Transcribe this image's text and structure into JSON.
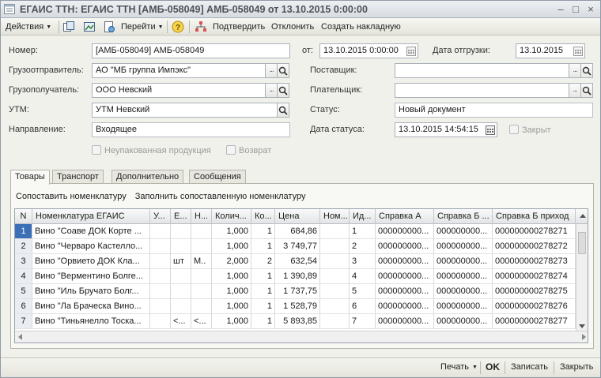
{
  "window": {
    "title": "ЕГАИС ТТН: ЕГАИС ТТН [АМБ-058049] АМБ-058049 от 13.10.2015 0:00:00",
    "controls": [
      "minimize-icon",
      "restore-icon",
      "close-icon"
    ]
  },
  "toolbar": {
    "actions_label": "Действия",
    "goto_label": "Перейти",
    "confirm_label": "Подтвердить",
    "reject_label": "Отклонить",
    "create_invoice_label": "Создать накладную",
    "icons": [
      "copy-icon",
      "image-icon",
      "document-refresh-icon",
      "help-icon",
      "structure-icon"
    ]
  },
  "form": {
    "number_label": "Номер:",
    "number_value": "[АМБ-058049] АМБ-058049",
    "date_from_label": "от:",
    "date_from_value": "13.10.2015  0:00:00",
    "shipment_date_label": "Дата отгрузки:",
    "shipment_date_value": "13.10.2015",
    "shipper_label": "Грузоотправитель:",
    "shipper_value": "АО \"МБ группа Импэкс\"",
    "supplier_label": "Поставщик:",
    "supplier_value": "",
    "consignee_label": "Грузополучатель:",
    "consignee_value": "ООО Невский",
    "payer_label": "Плательщик:",
    "payer_value": "",
    "utm_label": "УТМ:",
    "utm_value": "УТМ Невский",
    "status_label": "Статус:",
    "status_value": "Новый документ",
    "direction_label": "Направление:",
    "direction_value": "Входящее",
    "status_date_label": "Дата статуса:",
    "status_date_value": "13.10.2015 14:54:15",
    "closed_label": "Закрыт",
    "unpacked_label": "Неупакованная продукция",
    "return_label": "Возврат"
  },
  "tabs": [
    {
      "label": "Товары",
      "active": true
    },
    {
      "label": "Транспорт",
      "active": false
    },
    {
      "label": "Дополнительно",
      "active": false
    },
    {
      "label": "Сообщения",
      "active": false
    }
  ],
  "goods": {
    "match_label": "Сопоставить номенклатуру",
    "fill_label": "Заполнить сопоставленную номенклатуру",
    "columns": [
      "N",
      "Номенклатура ЕГАИС",
      "У...",
      "Е...",
      "Н...",
      "Колич...",
      "Ко...",
      "Цена",
      "Ном...",
      "Ид...",
      "Справка А",
      "Справка Б ...",
      "Справка Б приход"
    ],
    "rows": [
      {
        "n": "1",
        "name": "Вино \"Соаве ДОК Корте ...",
        "u": "",
        "e": "",
        "h": "",
        "qty": "1,000",
        "ko": "1",
        "price": "684,86",
        "nom": "",
        "id": "1",
        "ref_a": "000000000...",
        "ref_b": "000000000...",
        "ref_b_in": "000000000278271"
      },
      {
        "n": "2",
        "name": "Вино \"Черваро Кастелло...",
        "u": "",
        "e": "",
        "h": "",
        "qty": "1,000",
        "ko": "1",
        "price": "3 749,77",
        "nom": "",
        "id": "2",
        "ref_a": "000000000...",
        "ref_b": "000000000...",
        "ref_b_in": "000000000278272"
      },
      {
        "n": "3",
        "name": "Вино \"Орвието ДОК Кла...",
        "u": "",
        "e": "шт",
        "h": "М..",
        "qty": "2,000",
        "ko": "2",
        "price": "632,54",
        "nom": "",
        "id": "3",
        "ref_a": "000000000...",
        "ref_b": "000000000...",
        "ref_b_in": "000000000278273"
      },
      {
        "n": "4",
        "name": "Вино \"Верментино Болге...",
        "u": "",
        "e": "",
        "h": "",
        "qty": "1,000",
        "ko": "1",
        "price": "1 390,89",
        "nom": "",
        "id": "4",
        "ref_a": "000000000...",
        "ref_b": "000000000...",
        "ref_b_in": "000000000278274"
      },
      {
        "n": "5",
        "name": "Вино \"Иль Бручато Болг...",
        "u": "",
        "e": "",
        "h": "",
        "qty": "1,000",
        "ko": "1",
        "price": "1 737,75",
        "nom": "",
        "id": "5",
        "ref_a": "000000000...",
        "ref_b": "000000000...",
        "ref_b_in": "000000000278275"
      },
      {
        "n": "6",
        "name": "Вино \"Ла Браческа Вино...",
        "u": "",
        "e": "",
        "h": "",
        "qty": "1,000",
        "ko": "1",
        "price": "1 528,79",
        "nom": "",
        "id": "6",
        "ref_a": "000000000...",
        "ref_b": "000000000...",
        "ref_b_in": "000000000278276"
      },
      {
        "n": "7",
        "name": "Вино \"Тиньянелло Тоска...",
        "u": "",
        "e": "<...",
        "h": "<...",
        "qty": "1,000",
        "ko": "1",
        "price": "5 893,85",
        "nom": "",
        "id": "7",
        "ref_a": "000000000...",
        "ref_b": "000000000...",
        "ref_b_in": "000000000278277"
      }
    ]
  },
  "footer": {
    "print_label": "Печать",
    "ok_label": "OK",
    "save_label": "Записать",
    "close_label": "Закрыть"
  },
  "colors": {
    "selection": "#3b6fb6",
    "background": "#f1f1ec",
    "title_text": "#4f5357"
  }
}
